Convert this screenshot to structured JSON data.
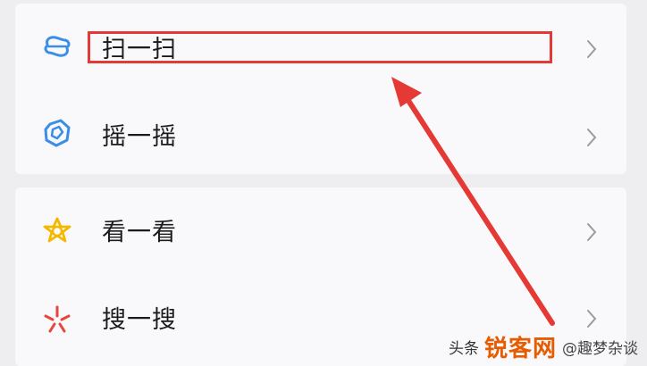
{
  "menu": {
    "groups": [
      {
        "items": [
          {
            "label": "扫一扫",
            "icon": "scan-icon",
            "highlighted": true
          },
          {
            "label": "摇一摇",
            "icon": "shake-icon"
          }
        ]
      },
      {
        "items": [
          {
            "label": "看一看",
            "icon": "look-icon"
          },
          {
            "label": "搜一搜",
            "icon": "search-icon"
          }
        ]
      }
    ]
  },
  "annotation": {
    "color": "#e53935"
  },
  "watermark": {
    "source": "头条",
    "site": "锐客网",
    "account": "@趣梦杂谈"
  }
}
